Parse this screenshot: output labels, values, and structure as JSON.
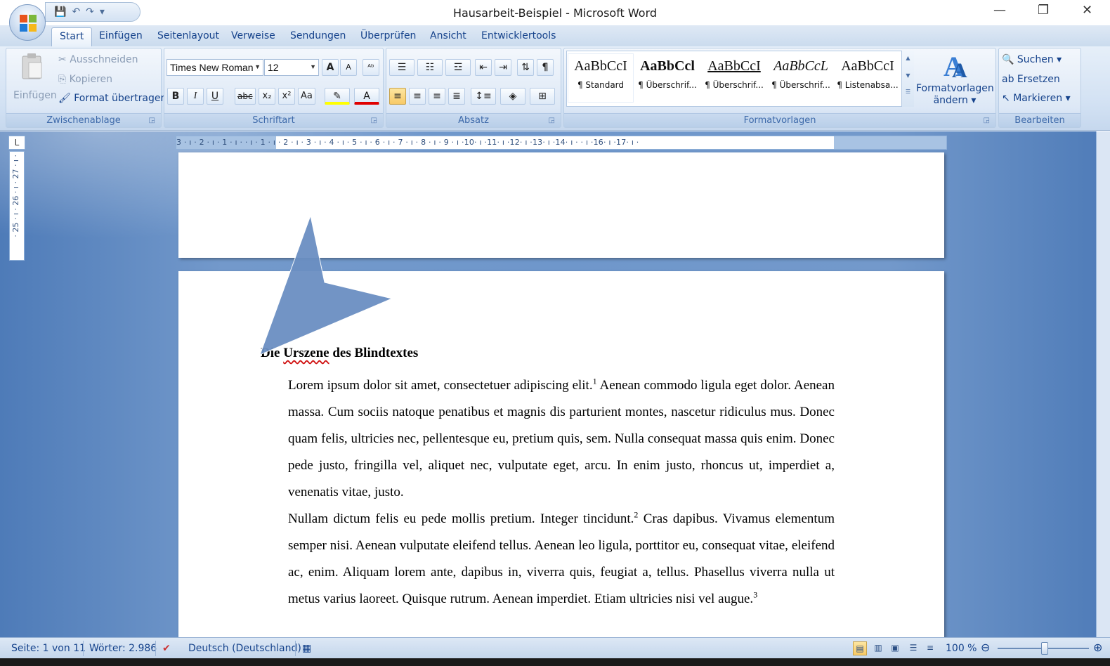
{
  "window": {
    "title": "Hausarbeit-Beispiel - Microsoft Word",
    "minimize_glyph": "—",
    "restore_glyph": "❐",
    "close_glyph": "✕"
  },
  "qat": {
    "save_icon": "💾",
    "undo_icon": "↶",
    "redo_icon": "↷",
    "more": "▾"
  },
  "tabs": [
    "Start",
    "Einfügen",
    "Seitenlayout",
    "Verweise",
    "Sendungen",
    "Überprüfen",
    "Ansicht",
    "Entwicklertools"
  ],
  "clipboard": {
    "paste": "Einfügen",
    "cut": "Ausschneiden",
    "copy": "Kopieren",
    "format_painter": "Format übertragen",
    "label": "Zwischenablage"
  },
  "font": {
    "name": "Times New Roman",
    "size": "12",
    "label": "Schriftart",
    "bold": "B",
    "italic": "I",
    "underline": "U",
    "strike": "abc",
    "subscript": "x₂",
    "superscript": "x²",
    "case": "Aa",
    "grow": "A",
    "shrink": "A"
  },
  "paragraph": {
    "label": "Absatz",
    "pilcrow": "¶"
  },
  "styles": {
    "label": "Formatvorlagen",
    "items": [
      {
        "preview": "AaBbCcI",
        "name": "¶ Standard"
      },
      {
        "preview": "AaBbCcl",
        "name": "¶ Überschrif..."
      },
      {
        "preview": "AaBbCcI",
        "name": "¶ Überschrif..."
      },
      {
        "preview": "AaBbCcL",
        "name": "¶ Überschrif..."
      },
      {
        "preview": "AaBbCcI",
        "name": "¶ Listenabsa..."
      }
    ],
    "change_line1": "Formatvorlagen",
    "change_line2": "ändern"
  },
  "editing": {
    "label": "Bearbeiten",
    "find": "Suchen",
    "replace": "Ersetzen",
    "select": "Markieren"
  },
  "ruler": {
    "h_numbers": "3 · ı · 2 · ı · 1 · ı ·   · ı · 1 · ı · 2 · ı · 3 · ı · 4 · ı · 5 · ı · 6 · ı · 7 · ı · 8 · ı · 9 · ı ·10· ı ·11· ı ·12· ı ·13· ı ·14· ı ·   · ı ·16· ı ·17· ı ·",
    "v_numbers": "· 25 · ı · 26 · ı · 27 · ı ·",
    "tab_selector": "L"
  },
  "document": {
    "heading_pre": "Die ",
    "heading_sq": "Urszene",
    "heading_post": " des Blindtextes",
    "p1_a": "Lorem ipsum dolor sit amet, consectetuer adipiscing elit.",
    "p1_sup": "1",
    "p1_b": " Aenean commodo ligula eget dolor. Aenean massa. Cum sociis natoque penatibus et magnis dis parturient montes, nascetur ridiculus mus. Donec quam felis, ultricies nec, pellentesque eu, pretium quis, sem. Nulla consequat massa quis enim. Donec pede justo, fringilla vel, aliquet nec, vulputate eget, arcu. In enim justo, rhoncus ut, imperdiet a, venenatis vitae, justo.",
    "p2_a": "Nullam dictum felis eu pede mollis pretium. Integer tincidunt.",
    "p2_sup": "2",
    "p2_b": " Cras dapibus. Vivamus elementum semper nisi. Aenean vulputate eleifend tellus. Aenean leo ligula, porttitor eu, consequat vitae, eleifend ac, enim. Aliquam lorem ante, dapibus in, viverra quis, feugiat a, tellus. Phasellus viverra nulla ut metus varius laoreet. Quisque rutrum. Aenean imperdiet. Etiam ultricies nisi vel augue.",
    "p2_sup2": "3"
  },
  "status": {
    "page": "Seite: 1 von 11",
    "words": "Wörter: 2.986",
    "language": "Deutsch (Deutschland)",
    "zoom": "100 %"
  },
  "colors": {
    "accent": "#15428b",
    "shape_fill": "#6b8fc2",
    "highlight": "#ffff00",
    "font_color": "#e00000"
  }
}
